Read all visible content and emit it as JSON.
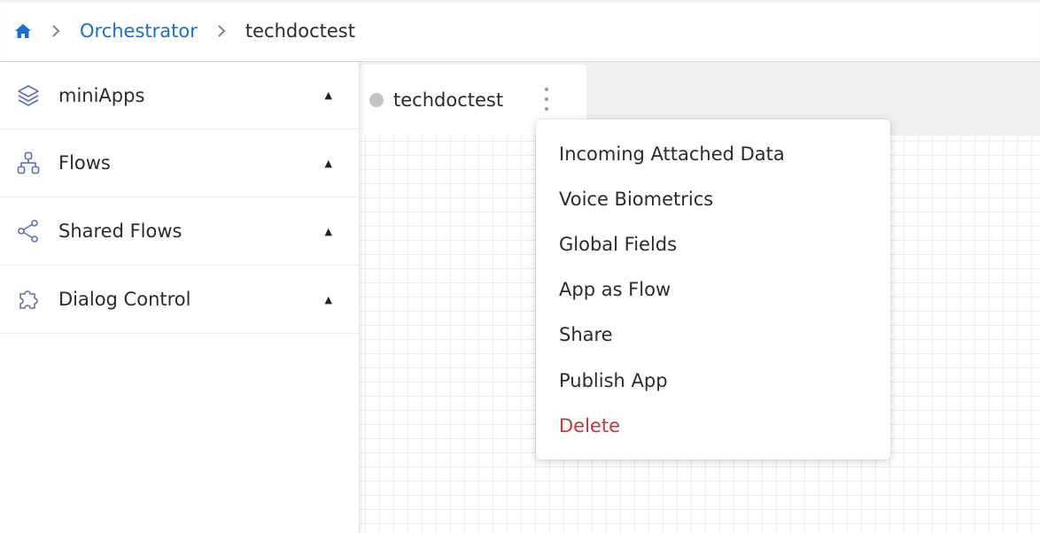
{
  "breadcrumb": {
    "home_icon": "home-icon",
    "items": [
      {
        "label": "Orchestrator"
      },
      {
        "label": "techdoctest"
      }
    ]
  },
  "sidebar": {
    "items": [
      {
        "label": "miniApps",
        "icon": "layers-icon"
      },
      {
        "label": "Flows",
        "icon": "flow-tree-icon"
      },
      {
        "label": "Shared Flows",
        "icon": "share-icon"
      },
      {
        "label": "Dialog Control",
        "icon": "puzzle-icon"
      }
    ],
    "caret": "▲"
  },
  "tab": {
    "title": "techdoctest",
    "status_color": "#c4c4c4"
  },
  "context_menu": {
    "items": [
      {
        "label": "Incoming Attached Data"
      },
      {
        "label": "Voice Biometrics"
      },
      {
        "label": "Global Fields"
      },
      {
        "label": "App as Flow"
      },
      {
        "label": "Share"
      },
      {
        "label": "Publish App"
      },
      {
        "label": "Delete"
      }
    ]
  },
  "colors": {
    "link": "#1a6fd1",
    "danger": "#d0303e",
    "icon": "#5b6fb5"
  }
}
